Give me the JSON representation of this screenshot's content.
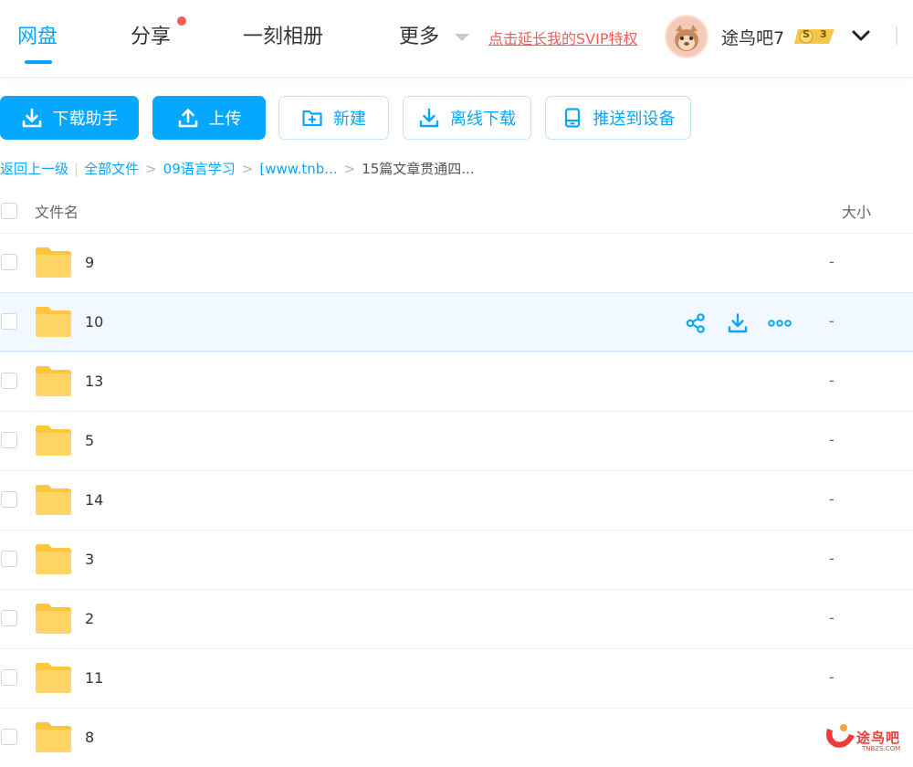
{
  "nav": {
    "tabs": [
      {
        "label": "网盘",
        "active": true
      },
      {
        "label": "分享",
        "has_dot": true
      },
      {
        "label": "一刻相册"
      },
      {
        "label": "更多",
        "has_caret": true
      }
    ],
    "promo": "点击延长我的SVIP特权",
    "user": {
      "name": "途鸟吧7",
      "badge_letter": "S",
      "badge_level": "3"
    }
  },
  "toolbar": {
    "buttons": [
      {
        "label": "下载助手",
        "icon": "download-icon",
        "style": "primary"
      },
      {
        "label": "上传",
        "icon": "upload-icon",
        "style": "primary"
      },
      {
        "label": "新建",
        "icon": "new-folder-icon",
        "style": "outline"
      },
      {
        "label": "离线下载",
        "icon": "download-icon",
        "style": "outline"
      },
      {
        "label": "推送到设备",
        "icon": "device-icon",
        "style": "outline"
      }
    ]
  },
  "breadcrumb": {
    "back": "返回上一级",
    "separator": "|",
    "items": [
      "全部文件",
      "09语言学习",
      "[www.tnb..."
    ],
    "arrow": ">",
    "current": "15篇文章贯通四..."
  },
  "table": {
    "col_name": "文件名",
    "col_size": "大小",
    "rows": [
      {
        "name": "9",
        "size": "-"
      },
      {
        "name": "10",
        "size": "-",
        "hover": true
      },
      {
        "name": "13",
        "size": "-"
      },
      {
        "name": "5",
        "size": "-"
      },
      {
        "name": "14",
        "size": "-"
      },
      {
        "name": "3",
        "size": "-"
      },
      {
        "name": "2",
        "size": "-"
      },
      {
        "name": "11",
        "size": "-"
      },
      {
        "name": "8",
        "size": ""
      }
    ],
    "row_actions": [
      "share-icon",
      "download-icon",
      "more-icon"
    ]
  },
  "watermark": {
    "text": "途鸟吧",
    "sub": "TNBZS.COM"
  },
  "colors": {
    "accent": "#06a7ff",
    "promo": "#f25d5d",
    "folder": "#ffd666",
    "hover_row": "#f1f8ff"
  }
}
